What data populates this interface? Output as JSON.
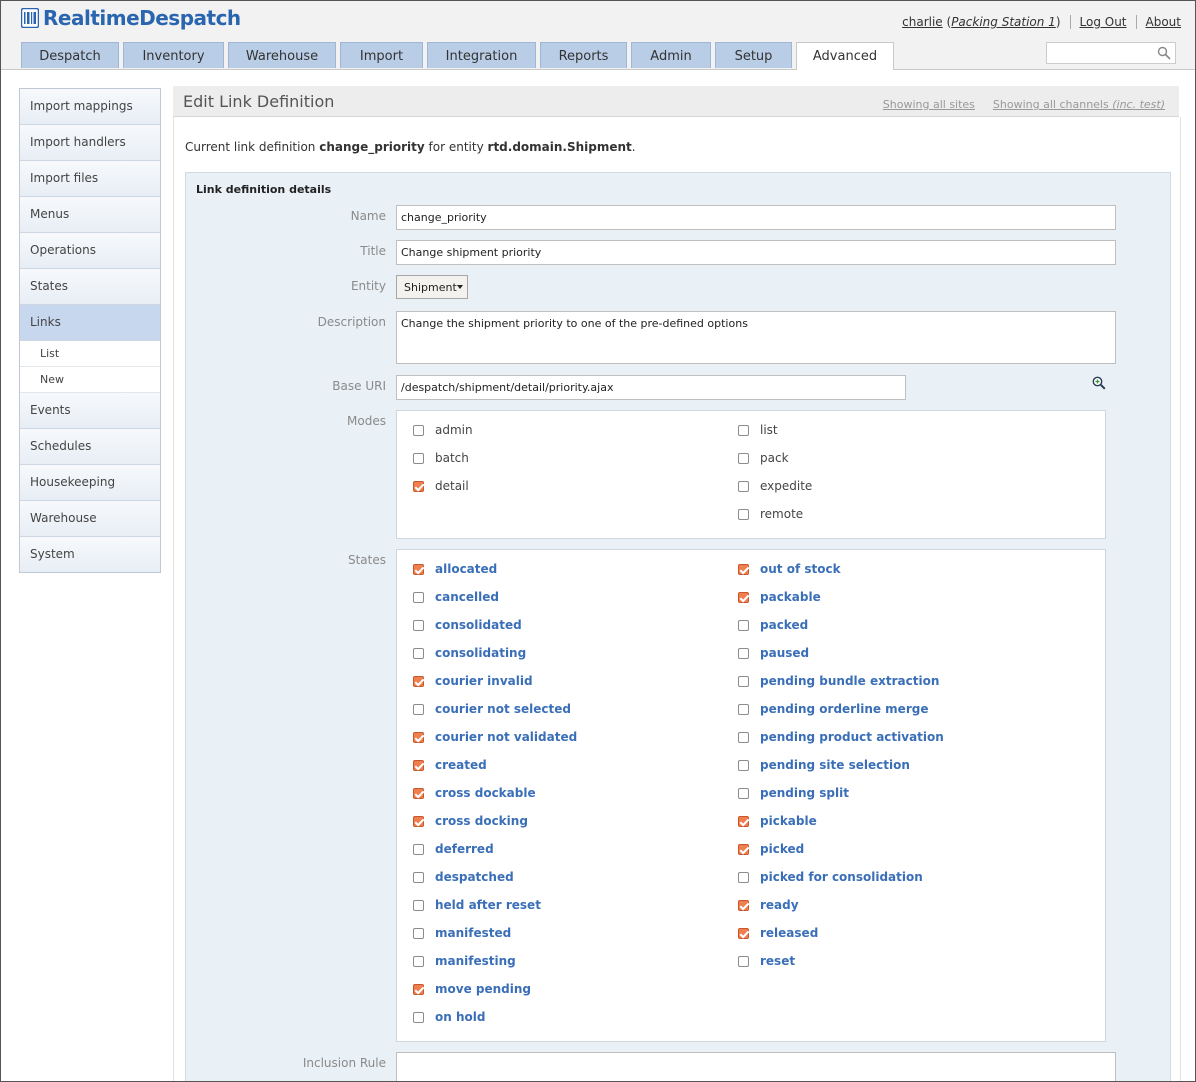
{
  "app": {
    "brand": "RealtimeDespatch"
  },
  "top_links": {
    "user": "charlie",
    "station": "Packing Station 1",
    "logout": "Log Out",
    "about": "About"
  },
  "tabs": [
    "Despatch",
    "Inventory",
    "Warehouse",
    "Import",
    "Integration",
    "Reports",
    "Admin",
    "Setup",
    "Advanced"
  ],
  "active_tab": "Advanced",
  "sidebar": {
    "items": [
      "Import mappings",
      "Import handlers",
      "Import files",
      "Menus",
      "Operations",
      "States",
      "Links",
      "Events",
      "Schedules",
      "Housekeeping",
      "Warehouse",
      "System"
    ],
    "active": "Links",
    "sub_items": [
      "List",
      "New"
    ]
  },
  "page": {
    "title": "Edit Link Definition",
    "showing_sites": "Showing all sites",
    "showing_channels": "Showing all channels",
    "showing_channels_suffix": "(inc. test)",
    "intro_prefix": "Current link definition",
    "intro_name": "change_priority",
    "intro_middle": "for entity",
    "intro_entity": "rtd.domain.Shipment",
    "intro_end": "."
  },
  "form": {
    "section_title": "Link definition details",
    "labels": {
      "name": "Name",
      "title": "Title",
      "entity": "Entity",
      "description": "Description",
      "base_uri": "Base URI",
      "modes": "Modes",
      "states": "States",
      "inclusion_rule": "Inclusion Rule"
    },
    "name": "change_priority",
    "title": "Change shipment priority",
    "entity": "Shipment",
    "description": "Change the shipment priority to one of the pre-defined options",
    "base_uri": "/despatch/shipment/detail/priority.ajax",
    "inclusion_rule": ""
  },
  "modes": {
    "left": [
      {
        "label": "admin",
        "checked": false
      },
      {
        "label": "batch",
        "checked": false
      },
      {
        "label": "detail",
        "checked": true
      }
    ],
    "right": [
      {
        "label": "list",
        "checked": false
      },
      {
        "label": "pack",
        "checked": false
      },
      {
        "label": "expedite",
        "checked": false
      },
      {
        "label": "remote",
        "checked": false
      }
    ]
  },
  "states": {
    "left": [
      {
        "label": "allocated",
        "checked": true
      },
      {
        "label": "cancelled",
        "checked": false
      },
      {
        "label": "consolidated",
        "checked": false
      },
      {
        "label": "consolidating",
        "checked": false
      },
      {
        "label": "courier invalid",
        "checked": true
      },
      {
        "label": "courier not selected",
        "checked": false
      },
      {
        "label": "courier not validated",
        "checked": true
      },
      {
        "label": "created",
        "checked": true
      },
      {
        "label": "cross dockable",
        "checked": true
      },
      {
        "label": "cross docking",
        "checked": true
      },
      {
        "label": "deferred",
        "checked": false
      },
      {
        "label": "despatched",
        "checked": false
      },
      {
        "label": "held after reset",
        "checked": false
      },
      {
        "label": "manifested",
        "checked": false
      },
      {
        "label": "manifesting",
        "checked": false
      },
      {
        "label": "move pending",
        "checked": true
      },
      {
        "label": "on hold",
        "checked": false
      }
    ],
    "right": [
      {
        "label": "out of stock",
        "checked": true
      },
      {
        "label": "packable",
        "checked": true
      },
      {
        "label": "packed",
        "checked": false
      },
      {
        "label": "paused",
        "checked": false
      },
      {
        "label": "pending bundle extraction",
        "checked": false
      },
      {
        "label": "pending orderline merge",
        "checked": false
      },
      {
        "label": "pending product activation",
        "checked": false
      },
      {
        "label": "pending site selection",
        "checked": false
      },
      {
        "label": "pending split",
        "checked": false
      },
      {
        "label": "pickable",
        "checked": true
      },
      {
        "label": "picked",
        "checked": true
      },
      {
        "label": "picked for consolidation",
        "checked": false
      },
      {
        "label": "ready",
        "checked": true
      },
      {
        "label": "released",
        "checked": true
      },
      {
        "label": "reset",
        "checked": false
      }
    ]
  },
  "icons": {
    "search": "search-icon",
    "zoom": "zoom-in-icon",
    "logo": "barcode-logo-icon"
  },
  "colors": {
    "brand": "#2a65b0",
    "tab": "#b9cde6",
    "checked": "#f07f4f",
    "state_link": "#3a6fb8",
    "panel": "#e9f0f6"
  }
}
